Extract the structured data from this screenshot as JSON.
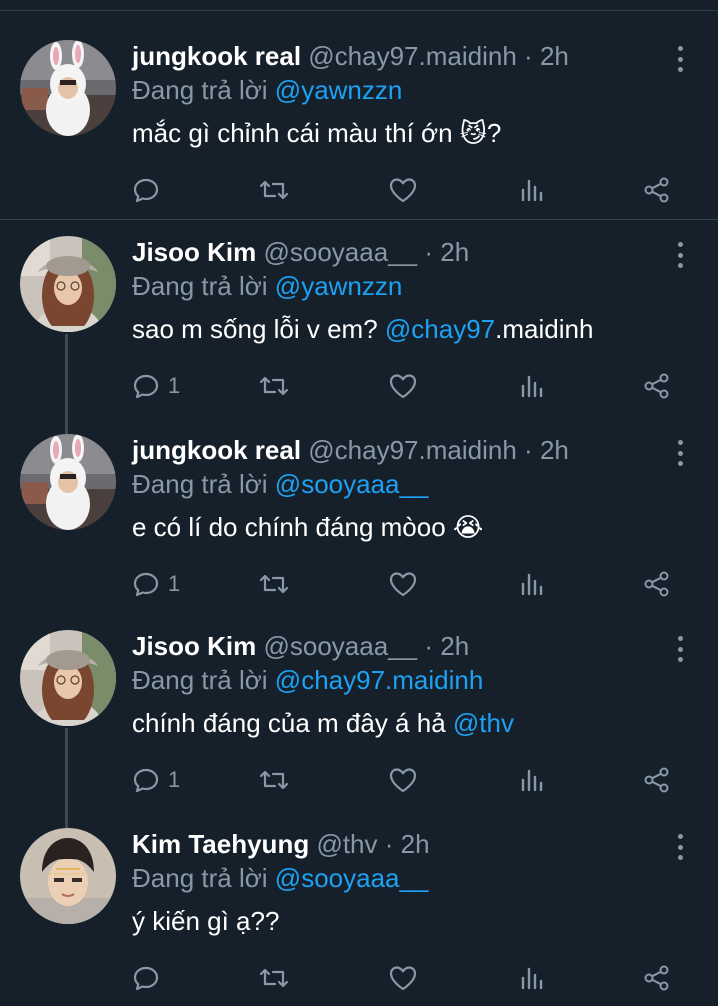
{
  "colors": {
    "background": "#15202b",
    "text": "#ffffff",
    "muted": "#8899a6",
    "link": "#1da1f2",
    "divider": "#38444d"
  },
  "tweets": [
    {
      "name": "jungkook real",
      "handle": "@chay97.maidinh",
      "dot": "·",
      "time": "2h",
      "replying_prefix": "Đang trả lời",
      "replying_to": "@yawnzzn",
      "body_text": "mắc gì chỉnh cái màu thí ớn",
      "body_emoji": "😼",
      "body_suffix": "?",
      "reply_count": "",
      "avatar": "bunny-hat-avatar"
    },
    {
      "name": "Jisoo Kim",
      "handle": "@sooyaaa__",
      "dot": "·",
      "time": "2h",
      "replying_prefix": "Đang trả lời",
      "replying_to": "@yawnzzn",
      "body_text": "sao m sống lỗi v em?",
      "body_mention": "@chay97",
      "body_suffix": ".maidinh",
      "reply_count": "1",
      "avatar": "hat-girl-avatar"
    },
    {
      "name": "jungkook real",
      "handle": "@chay97.maidinh",
      "dot": "·",
      "time": "2h",
      "replying_prefix": "Đang trả lời",
      "replying_to": "@sooyaaa__",
      "body_text": "e có lí do chính đáng mòoo",
      "body_emoji": "😭",
      "reply_count": "1",
      "avatar": "bunny-hat-avatar"
    },
    {
      "name": "Jisoo Kim",
      "handle": "@sooyaaa__",
      "dot": "·",
      "time": "2h",
      "replying_prefix": "Đang trả lời",
      "replying_to": "@chay97.maidinh",
      "body_text": "chính đáng của m đây á hả",
      "body_mention": "@thv",
      "reply_count": "1",
      "avatar": "hat-girl-avatar"
    },
    {
      "name": "Kim Taehyung",
      "handle": "@thv",
      "dot": "·",
      "time": "2h",
      "replying_prefix": "Đang trả lời",
      "replying_to": "@sooyaaa__",
      "body_text": "ý kiến gì ạ??",
      "reply_count": "",
      "avatar": "face-filter-avatar"
    }
  ]
}
